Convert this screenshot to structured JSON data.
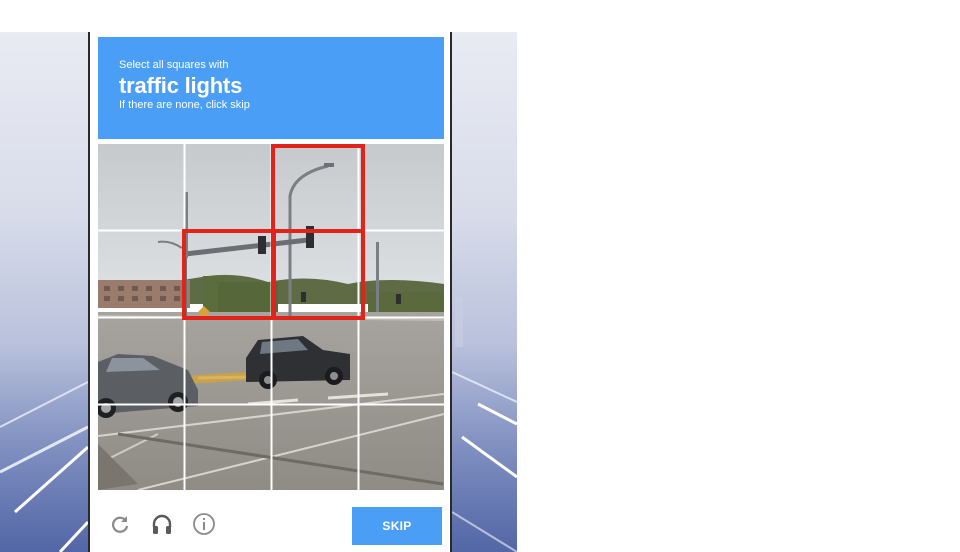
{
  "captcha": {
    "prompt_small": "Select all squares with",
    "prompt_target": "traffic lights",
    "prompt_hint": "If there are none, click skip",
    "grid_size": 4,
    "selected_tiles": [
      3,
      6,
      7
    ],
    "skip_label": "SKIP",
    "icons": [
      "reload-icon",
      "headphones-icon",
      "info-icon"
    ]
  },
  "colors": {
    "header_blue": "#4a9ef5",
    "selection_red": "#e2231a"
  }
}
